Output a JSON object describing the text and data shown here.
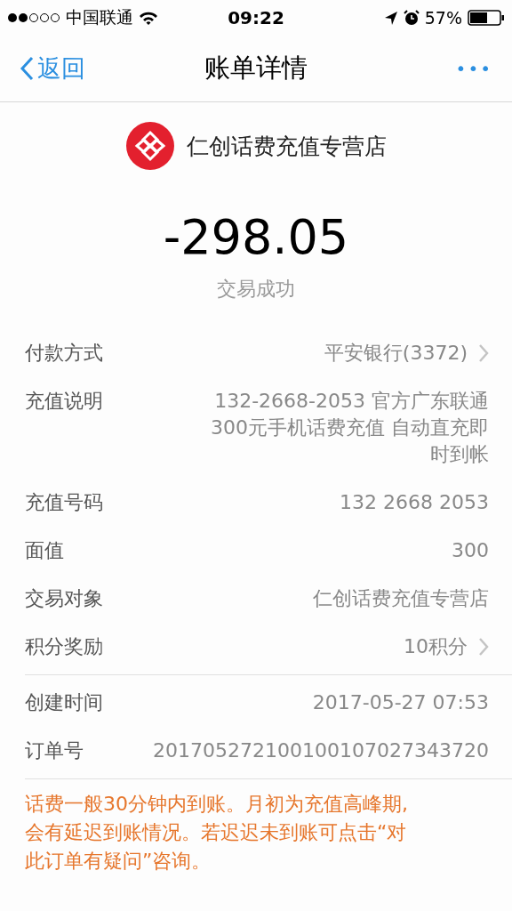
{
  "status_bar": {
    "carrier": "中国联通",
    "time": "09:22",
    "battery": "57%"
  },
  "nav": {
    "back": "返回",
    "title": "账单详情",
    "more": "•••"
  },
  "merchant": {
    "name": "仁创话费充值专营店"
  },
  "amount": "-298.05",
  "status": "交易成功",
  "details": [
    {
      "label": "付款方式",
      "value": [
        "平安银行(3372)"
      ],
      "arrow": true
    },
    {
      "label": "充值说明",
      "value": [
        "132-2668-2053 官方广东联通",
        "300元手机话费充值 自动直充即",
        "时到帐"
      ],
      "arrow": false
    },
    {
      "label": "充值号码",
      "value": [
        "132 2668 2053"
      ],
      "arrow": false
    },
    {
      "label": "面值",
      "value": [
        "300"
      ],
      "arrow": false
    },
    {
      "label": "交易对象",
      "value": [
        "仁创话费充值专营店"
      ],
      "arrow": false
    },
    {
      "label": "积分奖励",
      "value": [
        "10积分"
      ],
      "arrow": true
    }
  ],
  "order": [
    {
      "label": "创建时间",
      "value": [
        "2017-05-27 07:53"
      ],
      "arrow": false
    },
    {
      "label": "订单号",
      "value": [
        "201705272100100107027343720"
      ],
      "arrow": false
    }
  ],
  "notice": [
    "话费一般30分钟内到账。月初为充值高峰期,",
    "会有延迟到账情况。若迟迟未到账可点击“对",
    "此订单有疑问”咨询。"
  ]
}
